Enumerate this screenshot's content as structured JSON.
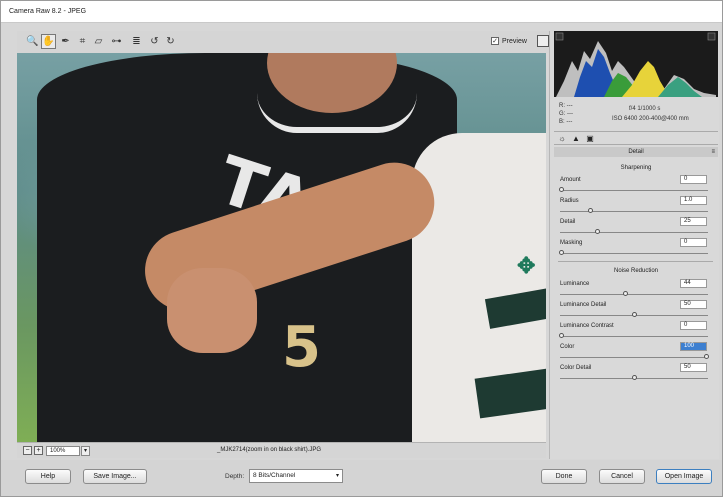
{
  "window": {
    "title": "Camera Raw 8.2  -  JPEG"
  },
  "toolbar": {
    "tools": [
      {
        "name": "zoom-tool-icon",
        "glyph": "🔍"
      },
      {
        "name": "hand-tool-icon",
        "glyph": "✋"
      },
      {
        "name": "white-balance-tool-icon",
        "glyph": "✒"
      },
      {
        "name": "crop-tool-icon",
        "glyph": "⌗"
      },
      {
        "name": "straighten-tool-icon",
        "glyph": "⏥"
      },
      {
        "name": "red-eye-tool-icon",
        "glyph": "⊶"
      },
      {
        "name": "preferences-icon",
        "glyph": "≣"
      },
      {
        "name": "rotate-left-icon",
        "glyph": "↺"
      },
      {
        "name": "rotate-right-icon",
        "glyph": "↻"
      }
    ],
    "preview_label": "Preview",
    "preview_checked": true
  },
  "image": {
    "jersey_text": "TAN",
    "jersey_number": "5"
  },
  "statusbar": {
    "zoom": "100%",
    "filename": "_MJK2714(zoom in on black shirt).JPG"
  },
  "readout": {
    "r": "R:   ---",
    "g": "G:   ---",
    "b": "B:   ---",
    "exif_line1": "f/4   1/1000 s",
    "exif_line2": "ISO 6400   200-400@400 mm"
  },
  "panel": {
    "header": "Detail",
    "sharpening": {
      "title": "Sharpening",
      "sliders": [
        {
          "label": "Amount",
          "value": "0",
          "position": 0.0
        },
        {
          "label": "Radius",
          "value": "1.0",
          "position": 0.2
        },
        {
          "label": "Detail",
          "value": "25",
          "position": 0.25
        },
        {
          "label": "Masking",
          "value": "0",
          "position": 0.0
        }
      ]
    },
    "noise": {
      "title": "Noise Reduction",
      "sliders": [
        {
          "label": "Luminance",
          "value": "44",
          "position": 0.44
        },
        {
          "label": "Luminance Detail",
          "value": "50",
          "position": 0.5
        },
        {
          "label": "Luminance Contrast",
          "value": "0",
          "position": 0.0
        },
        {
          "label": "Color",
          "value": "100",
          "position": 1.0,
          "selected": true
        },
        {
          "label": "Color Detail",
          "value": "50",
          "position": 0.5
        }
      ]
    }
  },
  "bottom": {
    "help": "Help",
    "save_image": "Save Image...",
    "depth_label": "Depth:",
    "depth_value": "8 Bits/Channel",
    "done": "Done",
    "cancel": "Cancel",
    "open_image": "Open Image"
  },
  "colors": {
    "accent": "#3c7fc0",
    "panel_bg": "#d9d9d9",
    "histogram_bg": "#1b1b1b"
  }
}
